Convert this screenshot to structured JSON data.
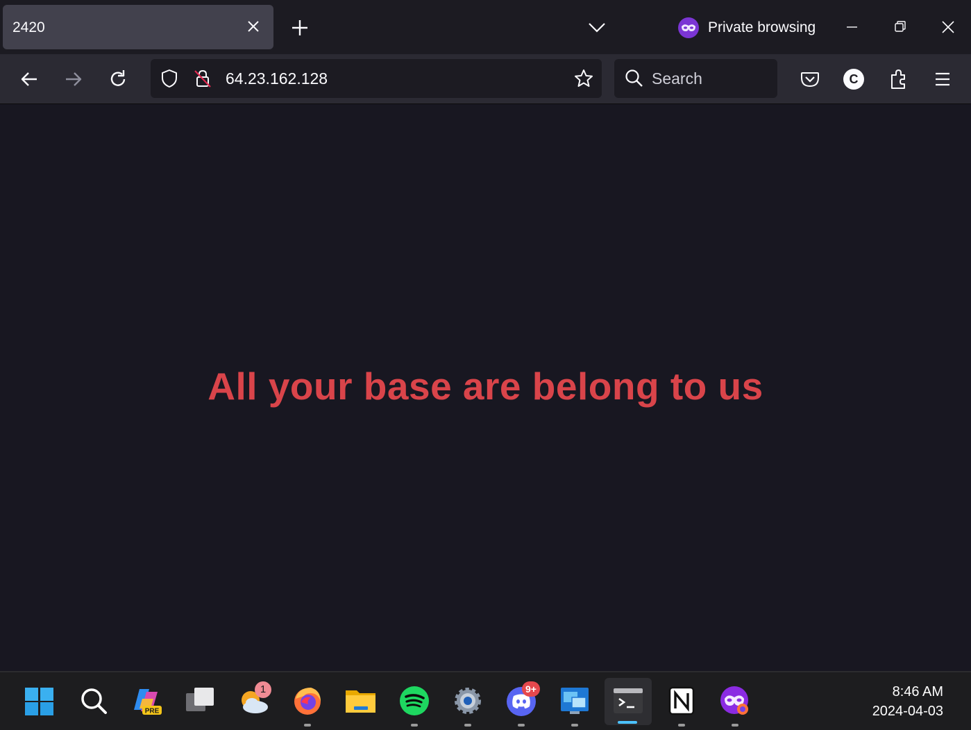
{
  "tab": {
    "title": "2420"
  },
  "window": {
    "private_label": "Private browsing"
  },
  "urlbar": {
    "url": "64.23.162.128"
  },
  "searchbar": {
    "placeholder": "Search"
  },
  "account": {
    "initial": "C"
  },
  "page": {
    "headline": "All your base are belong to us",
    "headline_color": "#d9444a"
  },
  "taskbar": {
    "weather_badge": "1",
    "discord_badge": "9+",
    "time": "8:46 AM",
    "date": "2024-04-03"
  }
}
